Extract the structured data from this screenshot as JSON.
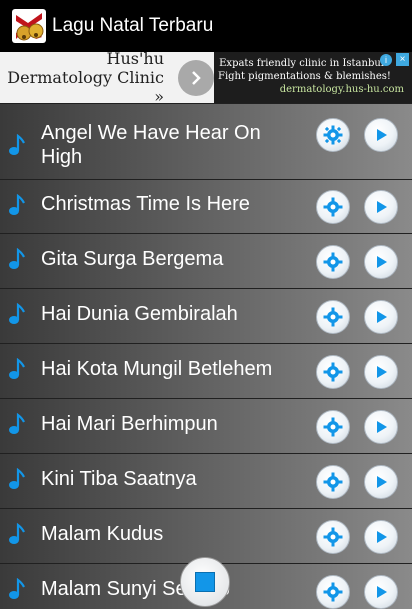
{
  "app": {
    "title": "Lagu Natal Terbaru"
  },
  "ad": {
    "left_text": "Hus'hu Dermatology Clinic »",
    "right_line1": "Expats friendly clinic in Istanbul",
    "right_line2": "Fight pigmentations & blemishes!",
    "right_url": "dermatology.hus-hu.com"
  },
  "songs": [
    "Angel We Have Hear On High",
    "Christmas Time Is Here",
    "Gita Surga Bergema",
    "Hai Dunia Gembiralah",
    "Hai Kota Mungil Betlehem",
    "Hai Mari Berhimpun",
    "Kini Tiba Saatnya",
    "Malam Kudus",
    "Malam Sunyi Senyap"
  ],
  "colors": {
    "accent": "#1296e8",
    "background": "#000000"
  }
}
